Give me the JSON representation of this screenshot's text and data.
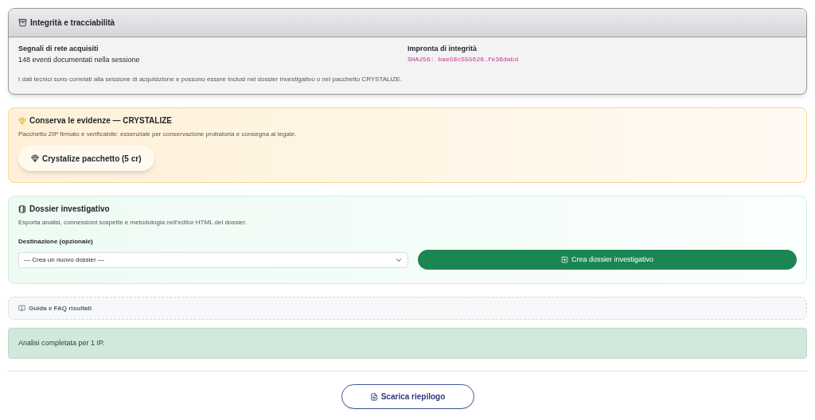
{
  "integrity": {
    "title": "Integrità e tracciabilità",
    "signals_label": "Segnali di rete acquisiti",
    "signals_value": "148 eventi documentati nella sessione",
    "hash_label": "Impronta di integrità",
    "hash_value": "SHA256: bae58c555626…fe36dabd",
    "note": "I dati tecnici sono correlati alla sessione di acquisizione e possono essere inclusi nel dossier investigativo o nel pacchetto CRYSTALIZE."
  },
  "crystalize": {
    "title": "Conserva le evidenze — CRYSTALIZE",
    "description": "Pacchetto ZIP firmato e verificabile: essenziale per conservazione probatoria e consegna al legale.",
    "button": "Crystalize pacchetto (5 cr)"
  },
  "dossier": {
    "title": "Dossier investigativo",
    "description": "Esporta analisi, connessioni sospette e metodologia nell’editor HTML del dossier.",
    "destination_label": "Destinazione (opzionale)",
    "destination_value": "— Crea un nuovo dossier —",
    "button": "Crea dossier investigativo"
  },
  "guide": {
    "label": "Guida e FAQ risultati"
  },
  "alert": {
    "text": "Analisi completata per 1 IP."
  },
  "download_button": "Scarica riepilogo"
}
